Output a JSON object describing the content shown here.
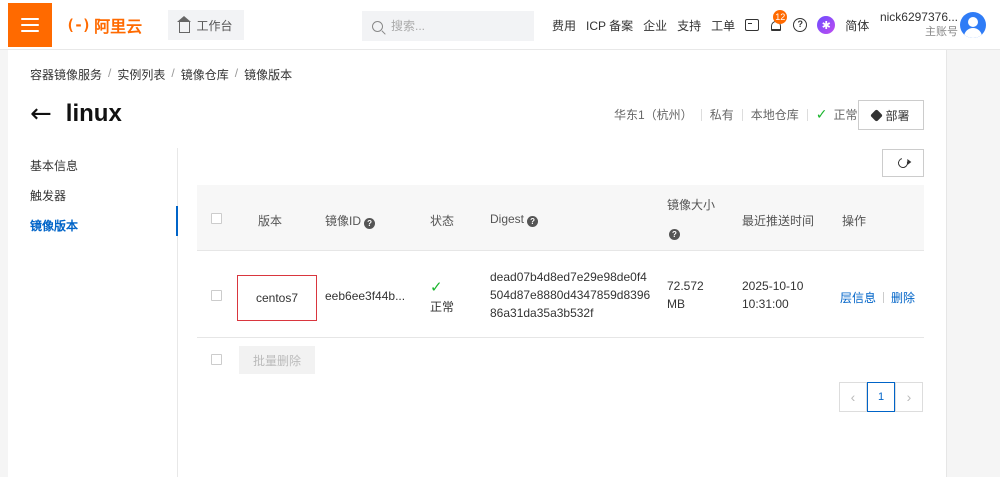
{
  "topbar": {
    "logo_text": "阿里云",
    "logo_mark": "(-)",
    "workbench_label": "工作台",
    "search_placeholder": "搜索...",
    "nav": [
      "费用",
      "ICP 备案",
      "企业",
      "支持",
      "工单"
    ],
    "notification_count": "12",
    "language": "简体",
    "user_name": "nick6297376...",
    "user_role": "主账号"
  },
  "breadcrumb": [
    "容器镜像服务",
    "实例列表",
    "镜像仓库",
    "镜像版本"
  ],
  "page": {
    "title": "linux",
    "region": "华东1（杭州）",
    "visibility": "私有",
    "repo_type": "本地仓库",
    "status": "正常",
    "deploy_label": "部署"
  },
  "side_menu": {
    "items": [
      "基本信息",
      "触发器",
      "镜像版本"
    ],
    "active_index": 2
  },
  "table": {
    "headers": {
      "version": "版本",
      "image_id": "镜像ID",
      "status": "状态",
      "digest": "Digest",
      "size": "镜像大小",
      "pushed": "最近推送时间",
      "ops": "操作"
    },
    "rows": [
      {
        "version": "centos7",
        "image_id": "eeb6ee3f44b...",
        "status": "正常",
        "digest_lines": [
          "dead07b4d8ed7e29e98de0f4",
          "504d87e8880d4347859d8396",
          "86a31da35a3b532f"
        ],
        "size_value": "72.572",
        "size_unit": "MB",
        "pushed_date": "2025-10-10",
        "pushed_time": "10:31:00",
        "op_layers": "层信息",
        "op_delete": "删除"
      }
    ],
    "batch_delete_label": "批量删除"
  },
  "pagination": {
    "prev": "‹",
    "current": "1",
    "next": "›"
  },
  "colors": {
    "brand": "#ff6a00",
    "link": "#0064c8",
    "success": "#1bb52e",
    "highlight_border": "#d9363e"
  }
}
